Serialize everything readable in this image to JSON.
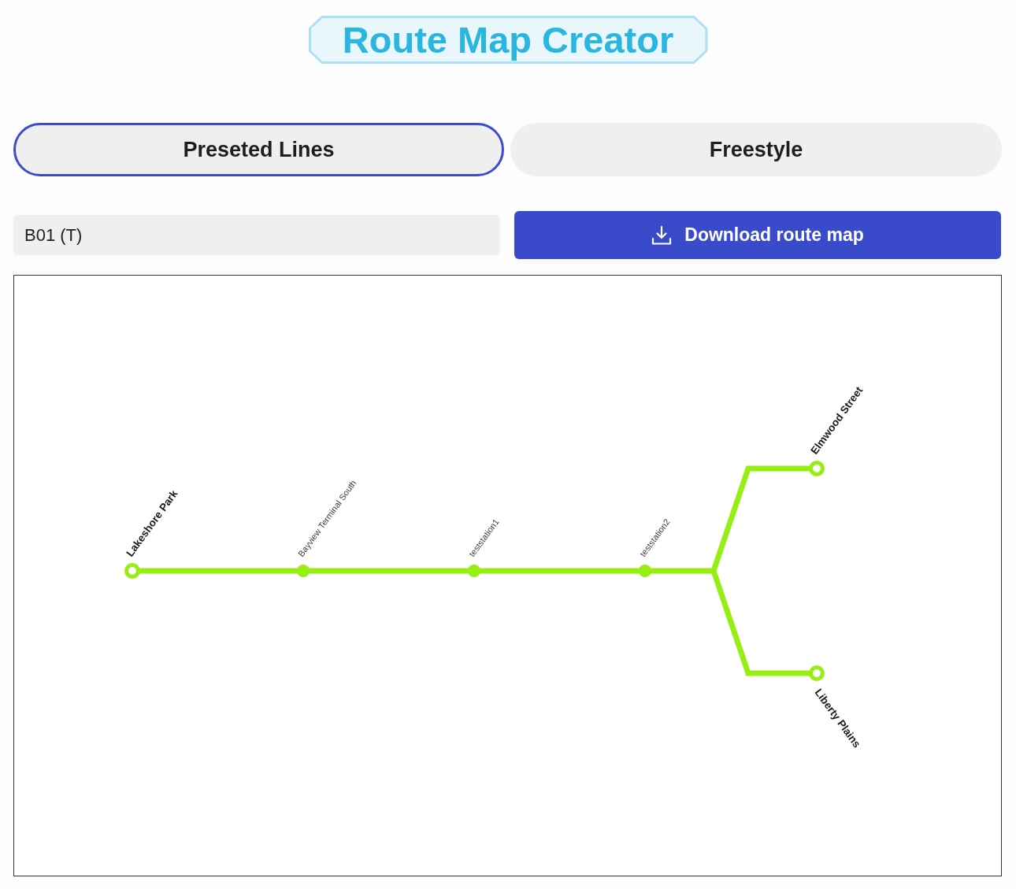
{
  "title": "Route Map Creator",
  "tabs": [
    {
      "label": "Preseted Lines",
      "selected": true
    },
    {
      "label": "Freestyle",
      "selected": false
    }
  ],
  "line_select": {
    "value": "B01 (T)"
  },
  "download_button": {
    "label": "Download route map"
  },
  "route_map": {
    "stations": [
      {
        "name": "Lakeshore Park",
        "kind": "terminal"
      },
      {
        "name": "Bayview Terminal South",
        "kind": "stop"
      },
      {
        "name": "teststation1",
        "kind": "stop"
      },
      {
        "name": "teststation2",
        "kind": "stop"
      }
    ],
    "branches": [
      {
        "stations": [
          {
            "name": "Elmwood Street",
            "kind": "terminal"
          }
        ]
      },
      {
        "stations": [
          {
            "name": "Liberty Plains",
            "kind": "terminal"
          }
        ]
      }
    ]
  }
}
